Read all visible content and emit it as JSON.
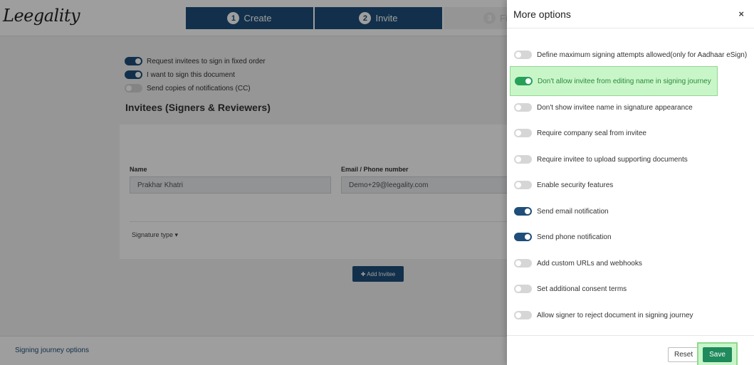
{
  "app": {
    "logo_text": "Leegality"
  },
  "steps": [
    {
      "number": "1",
      "label": "Create"
    },
    {
      "number": "2",
      "label": "Invite"
    },
    {
      "number": "3",
      "label": "Fi"
    }
  ],
  "page_options": [
    {
      "label": "Request invitees to sign in fixed order",
      "enabled": true
    },
    {
      "label": "I want to sign this document",
      "enabled": true
    },
    {
      "label": "Send copies of notifications (CC)",
      "enabled": false
    }
  ],
  "invitees": {
    "title": "Invitees (Signers & Reviewers)",
    "name_label": "Name",
    "name_value": "Prakhar Khatri",
    "email_label": "Email / Phone number",
    "email_value": "Demo+29@leegality.com",
    "signature_type_label": "Signature type ▾",
    "add_button": "✚ Add Invitee"
  },
  "footer": {
    "link": "Signing journey options"
  },
  "modal": {
    "title": "More options",
    "close": "×",
    "options": [
      {
        "label": "Define maximum signing attempts allowed(only for Aadhaar eSign)",
        "enabled": false
      },
      {
        "label": "Don't allow invitee from editing name in signing journey",
        "enabled": true,
        "highlighted": true
      },
      {
        "label": "Don't show invitee name in signature appearance",
        "enabled": false
      },
      {
        "label": "Require company seal from invitee",
        "enabled": false
      },
      {
        "label": "Require invitee to upload supporting documents",
        "enabled": false
      },
      {
        "label": "Enable security features",
        "enabled": false
      },
      {
        "label": "Send email notification",
        "enabled": true
      },
      {
        "label": "Send phone notification",
        "enabled": true
      },
      {
        "label": "Add custom URLs and webhooks",
        "enabled": false
      },
      {
        "label": "Set additional consent terms",
        "enabled": false
      },
      {
        "label": "Allow signer to reject document in signing journey",
        "enabled": false
      }
    ],
    "reset_label": "Reset",
    "save_label": "Save"
  },
  "colors": {
    "primary": "#1e4e79",
    "success": "#1f8a5b",
    "highlight": "#c9f6c9"
  }
}
